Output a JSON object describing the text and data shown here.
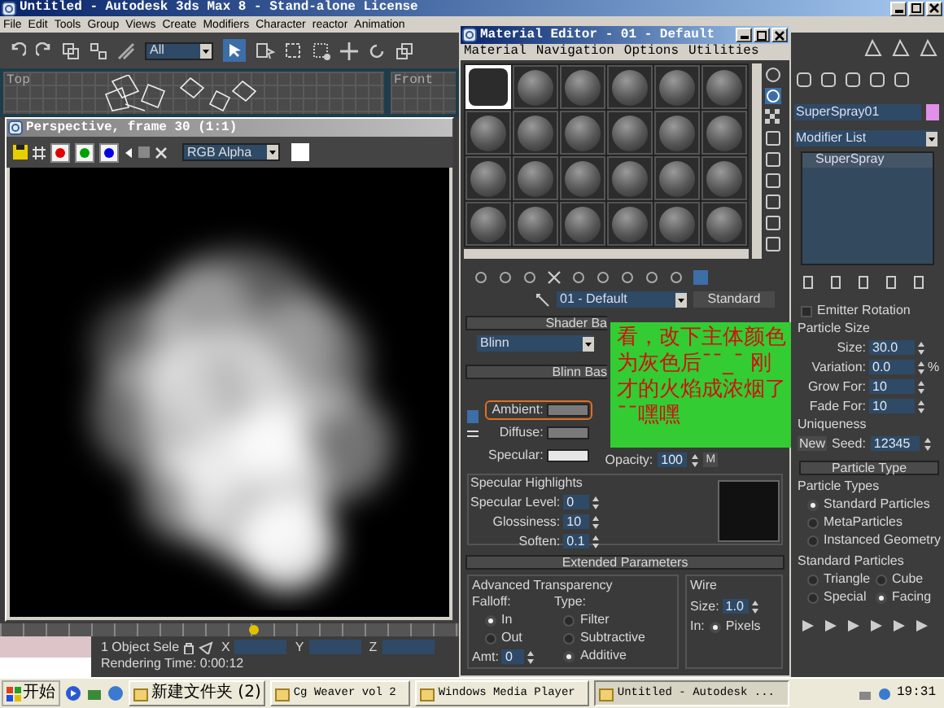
{
  "app_window": {
    "title": "Untitled - Autodesk 3ds Max 8  - Stand-alone License",
    "menu": [
      "File",
      "Edit",
      "Tools",
      "Group",
      "Views",
      "Create",
      "Modifiers",
      "Character",
      "reactor",
      "Animation"
    ],
    "selection_filter": "All",
    "viewports": [
      {
        "label": "Top"
      },
      {
        "label": "Front"
      }
    ]
  },
  "render_window": {
    "title": "Perspective, frame 30 (1:1)",
    "channel_buttons": [
      {
        "color": "#e00000"
      },
      {
        "color": "#00a000"
      },
      {
        "color": "#0000e0"
      }
    ],
    "display": "RGB Alpha"
  },
  "status": {
    "selection": "1 Object Sele",
    "coords": [
      {
        "label": "X"
      },
      {
        "label": "Y"
      },
      {
        "label": "Z"
      }
    ],
    "prompt": "Rendering Time: 0:00:12"
  },
  "material_editor": {
    "title": "Material Editor - 01 - Default",
    "menu": [
      "Material",
      "Navigation",
      "Options",
      "Utilities"
    ],
    "slots": [
      {
        "selected": true
      },
      {
        "selected": false
      },
      {
        "selected": false
      },
      {
        "selected": false
      },
      {
        "selected": false
      },
      {
        "selected": false
      },
      {
        "selected": false
      },
      {
        "selected": false
      },
      {
        "selected": false
      },
      {
        "selected": false
      },
      {
        "selected": false
      },
      {
        "selected": false
      },
      {
        "selected": false
      },
      {
        "selected": false
      },
      {
        "selected": false
      },
      {
        "selected": false
      },
      {
        "selected": false
      },
      {
        "selected": false
      },
      {
        "selected": false
      },
      {
        "selected": false
      },
      {
        "selected": false
      },
      {
        "selected": false
      },
      {
        "selected": false
      },
      {
        "selected": false
      }
    ],
    "material_name": "01 - Default",
    "material_type": "Standard",
    "shader_rollout": "Shader Ba",
    "shader": "Blinn",
    "blinn_rollout": "Blinn Bas",
    "colors": [
      {
        "label": "Ambient:",
        "color": "#7a7a7a",
        "highlighted": true
      },
      {
        "label": "Diffuse:",
        "color": "#7a7a7a",
        "highlighted": false
      },
      {
        "label": "Specular:",
        "color": "#e6e6e6",
        "highlighted": false
      }
    ],
    "opacity": {
      "label": "Opacity:",
      "value": "100",
      "map": "M"
    },
    "specular_highlights": {
      "title": "Specular Highlights",
      "fields": [
        {
          "label": "Specular Level:",
          "value": "0"
        },
        {
          "label": "Glossiness:",
          "value": "10"
        },
        {
          "label": "Soften:",
          "value": "0.1"
        }
      ]
    },
    "extended": {
      "title": "Extended Parameters",
      "group": "Advanced Transparency",
      "falloff_label": "Falloff:",
      "falloff": [
        {
          "label": "In",
          "selected": true
        },
        {
          "label": "Out",
          "selected": false
        }
      ],
      "type_label": "Type:",
      "types": [
        {
          "label": "Filter",
          "selected": false
        },
        {
          "label": "Subtractive",
          "selected": false
        },
        {
          "label": "Additive",
          "selected": true
        }
      ],
      "amount": {
        "label": "Amt:",
        "value": "0"
      },
      "wire": {
        "title": "Wire",
        "size_label": "Size:",
        "size": "1.0",
        "units_label": "In:",
        "units": [
          {
            "label": "Pixels",
            "selected": true
          }
        ]
      }
    }
  },
  "annotation": {
    "text": "看，改下主体颜色为灰色后¯ˉ_ˉ 刚才的火焰成浓烟了¯¯嘿嘿"
  },
  "command_panel": {
    "object_name": "SuperSpray01",
    "modifier_list": "Modifier List",
    "stack": [
      "SuperSpray"
    ],
    "emitter_rotation": {
      "label": "Emitter Rotation",
      "checked": false
    },
    "particle_size": {
      "title": "Particle Size",
      "fields": [
        {
          "label": "Size:",
          "value": "30.0"
        },
        {
          "label": "Variation:",
          "value": "0.0",
          "unit": "%"
        },
        {
          "label": "Grow For:",
          "value": "10"
        },
        {
          "label": "Fade For:",
          "value": "10"
        }
      ]
    },
    "uniqueness": {
      "title": "Uniqueness",
      "button": "New",
      "seed_label": "Seed:",
      "seed": "12345"
    },
    "particle_type_rollout": "Particle Type",
    "particle_types": {
      "title": "Particle Types",
      "options": [
        {
          "label": "Standard Particles",
          "selected": true
        },
        {
          "label": "MetaParticles",
          "selected": false
        },
        {
          "label": "Instanced Geometry",
          "selected": false
        }
      ]
    },
    "standard_particles": {
      "title": "Standard Particles",
      "options": [
        {
          "label": "Triangle",
          "selected": false
        },
        {
          "label": "Cube",
          "selected": false
        },
        {
          "label": "Special",
          "selected": false
        },
        {
          "label": "Facing",
          "selected": true
        }
      ]
    }
  },
  "taskbar": {
    "start": "开始",
    "tasks": [
      {
        "label": "新建文件夹 (2)",
        "selected": false
      },
      {
        "label": "Cg Weaver vol 2",
        "selected": false
      },
      {
        "label": "Windows Media Player",
        "selected": false
      },
      {
        "label": "Untitled - Autodesk ...",
        "selected": true
      }
    ],
    "clock": "19:31"
  }
}
